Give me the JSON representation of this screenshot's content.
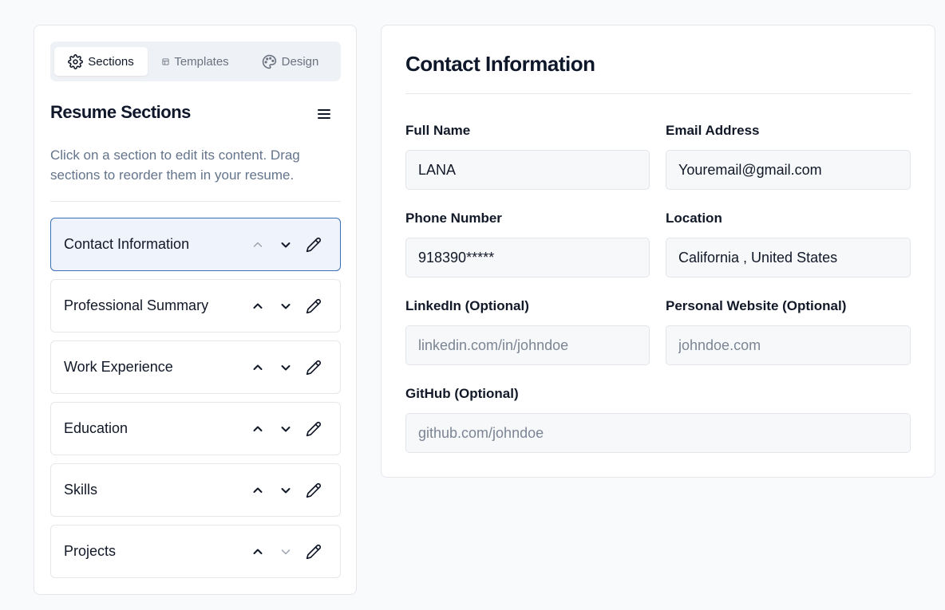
{
  "tabs": [
    {
      "label": "Sections",
      "icon": "gear-icon",
      "active": true
    },
    {
      "label": "Templates",
      "icon": "template-icon",
      "active": false
    },
    {
      "label": "Design",
      "icon": "palette-icon",
      "active": false
    }
  ],
  "sidebar": {
    "title": "Resume Sections",
    "help_text": "Click on a section to edit its content. Drag sections to reorder them in your resume.",
    "sections": [
      {
        "label": "Contact Information",
        "active": true
      },
      {
        "label": "Professional Summary",
        "active": false
      },
      {
        "label": "Work Experience",
        "active": false
      },
      {
        "label": "Education",
        "active": false
      },
      {
        "label": "Skills",
        "active": false
      },
      {
        "label": "Projects",
        "active": false
      }
    ]
  },
  "form": {
    "title": "Contact Information",
    "full_name": {
      "label": "Full Name",
      "value": "LANA",
      "placeholder": ""
    },
    "email": {
      "label": "Email Address",
      "value": "Youremail@gmail.com",
      "placeholder": ""
    },
    "phone": {
      "label": "Phone Number",
      "value": "918390*****",
      "placeholder": ""
    },
    "location": {
      "label": "Location",
      "value": "California , United States",
      "placeholder": ""
    },
    "linkedin": {
      "label": "LinkedIn (Optional)",
      "value": "",
      "placeholder": "linkedin.com/in/johndoe"
    },
    "website": {
      "label": "Personal Website (Optional)",
      "value": "",
      "placeholder": "johndoe.com"
    },
    "github": {
      "label": "GitHub (Optional)",
      "value": "",
      "placeholder": "github.com/johndoe"
    }
  },
  "colors": {
    "active_border": "#3b6fb6",
    "active_bg": "#eff4fc",
    "page_bg": "#f9fafb"
  }
}
